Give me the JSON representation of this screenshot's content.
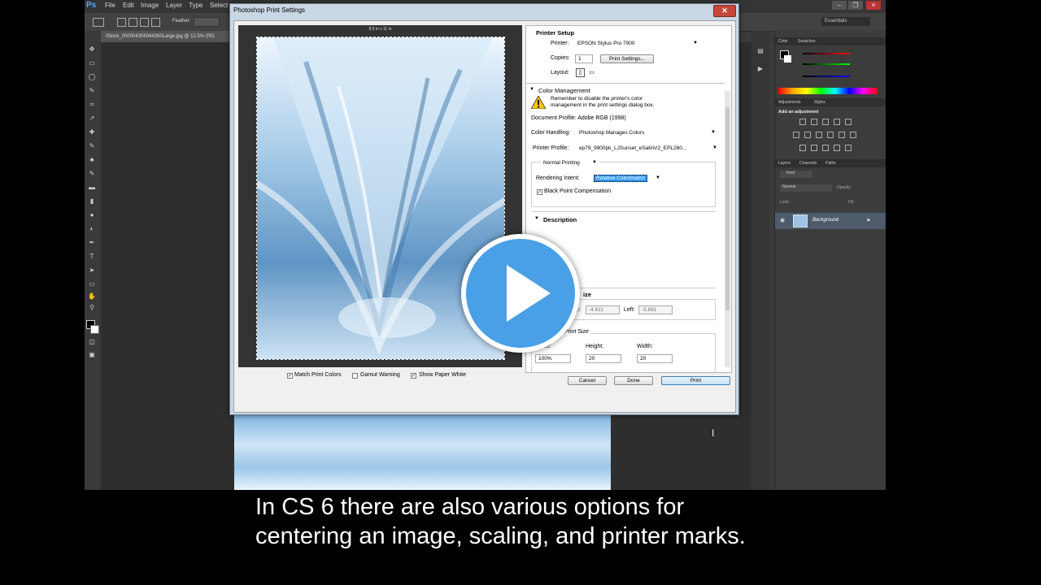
{
  "ps": {
    "logo": "Ps",
    "menu": [
      "File",
      "Edit",
      "Image",
      "Layer",
      "Type",
      "Select"
    ],
    "feather_label": "Feather:",
    "doc_tab": "iStock_000004306944300Large.jpg @ 12.5% (RG",
    "workspace": "Essentials",
    "color_tabs": [
      "Color",
      "Swatches"
    ],
    "adjust_tabs": [
      "Adjustments",
      "Styles"
    ],
    "adjust_title": "Add an adjustment",
    "layers_tabs": [
      "Layers",
      "Channels",
      "Paths"
    ],
    "kind_label": "Kind",
    "blend_mode": "Normal",
    "opacity_label": "Opacity:",
    "lock_label": "Lock:",
    "fill_label": "Fill:",
    "layer_name": "Background"
  },
  "dialog": {
    "title": "Photoshop Print Settings",
    "close_label": "✕",
    "paper_size": "8.5 in x 11 in",
    "match_print_colors": "Match Print Colors",
    "gamut_warning": "Gamut Warning",
    "show_paper_white": "Show Paper White",
    "printer_setup": {
      "heading": "Printer Setup",
      "printer_label": "Printer:",
      "printer_value": "EPSON Stylus Pro 7900",
      "copies_label": "Copies:",
      "copies_value": "1",
      "print_settings_btn": "Print Settings...",
      "layout_label": "Layout:"
    },
    "color_management": {
      "heading": "Color Management",
      "warning_text_1": "Remember to disable the printer's color",
      "warning_text_2": "management in the print settings dialog box.",
      "doc_profile": "Document Profile: Adobe RGB (1998)",
      "color_handling_label": "Color Handling:",
      "color_handling_value": "Photoshop Manages Colors",
      "printer_profile_label": "Printer Profile:",
      "printer_profile_value": "ep79_9900pk_LJSunset_eSatinV2_EPL260...",
      "normal_printing": "Normal Printing",
      "rendering_intent_label": "Rendering Intent:",
      "rendering_intent_value": "Relative Colorimetric",
      "bpc": "Black Point Compensation"
    },
    "description": {
      "heading": "Description"
    },
    "position": {
      "heading_partial": "ize",
      "top_label_partial": "p:",
      "top_value": "-4.611",
      "left_label": "Left:",
      "left_value": "-5.861"
    },
    "scaled_print_size": {
      "heading_partial": "Print Size",
      "scale_label": "Scale:",
      "scale_value": "100%",
      "height_label": "Height:",
      "height_value": "20",
      "width_label": "Width:",
      "width_value": "20"
    },
    "buttons": {
      "cancel": "Cancel",
      "done": "Done",
      "print": "Print"
    }
  },
  "caption": {
    "line1": "In CS 6 there are also various options for",
    "line2": "centering an image, scaling, and printer marks."
  },
  "colors": {
    "accent": "#4aa0e6",
    "selection": "#3399ff"
  }
}
